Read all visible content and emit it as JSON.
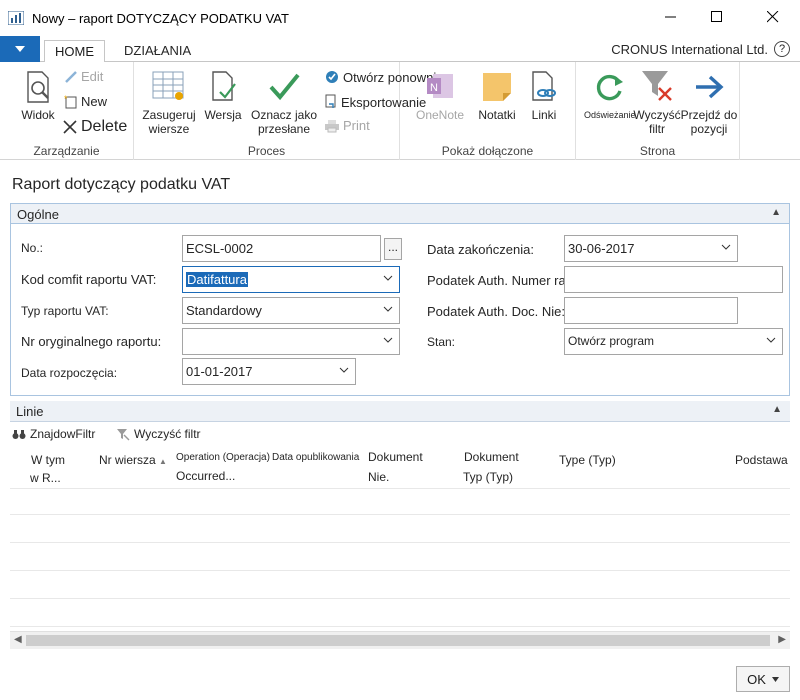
{
  "window": {
    "title": "Nowy – raport DOTYCZĄCY PODATKU VAT"
  },
  "tabs": [
    {
      "label": "HOME",
      "active": true
    },
    {
      "label": "DZIAŁANIA",
      "active": false
    }
  ],
  "company": "CRONUS International Ltd.",
  "ribbon": {
    "zarzadzanie": {
      "label": "Zarządzanie",
      "widok": "Widok",
      "edit": "Edit",
      "new": "New",
      "delete": "Delete"
    },
    "proces": {
      "label": "Proces",
      "zasugeruj": "Zasugeruj wiersze",
      "wersja": "Wersja",
      "oznacz": "Oznacz jako przesłane",
      "otworz": "Otwórz ponownie",
      "eksport": "Eksportowanie",
      "print": "Print"
    },
    "pokaz": {
      "label": "Pokaż dołączone",
      "onenote": "OneNote",
      "notatki": "Notatki",
      "linki": "Linki"
    },
    "strona": {
      "label": "Strona",
      "odswiezanie": "Odświeżanie",
      "wyczysc": "Wyczyść filtr",
      "przejdz": "Przejdź do pozycji"
    }
  },
  "page": {
    "title": "Raport dotyczący podatku VAT"
  },
  "general": {
    "header": "Ogólne",
    "no_label": "No.:",
    "no_value": "ECSL-0002",
    "kod_label": "Kod comfit raportu VAT:",
    "kod_value": "Datifattura",
    "typ_label": "Typ raportu VAT:",
    "typ_value": "Standardowy",
    "nr_label": "Nr oryginalnego raportu:",
    "nr_value": "",
    "data_roz_label": "Data rozpoczęcia:",
    "data_roz_value": "01-01-2017",
    "data_zak_label": "Data zakończenia:",
    "data_zak_value": "30-06-2017",
    "auth_rach_label": "Podatek Auth. Numer rachunku:",
    "auth_rach_value": "",
    "auth_doc_label": "Podatek Auth. Doc. Nie:",
    "auth_doc_value": "",
    "stan_label": "Stan:",
    "stan_value": "Otwórz program"
  },
  "lines": {
    "header": "Linie",
    "find_filter": "ZnajdowFiltr",
    "clear_filter": "Wyczyść filtr",
    "columns": {
      "w_tym": "W tym",
      "w_r": "w R...",
      "nr_wiersza": "Nr wiersza",
      "operation": "Operation (Operacja)",
      "occurred": "Occurred...",
      "data_opub": "Data opublikowania",
      "dok_nie_1": "Dokument",
      "dok_nie_2": "Nie.",
      "dok_typ_1": "Dokument",
      "dok_typ_2": "Typ (Typ)",
      "typ": "Type (Typ)",
      "podstawa": "Podstawa"
    }
  },
  "footer": {
    "ok": "OK"
  }
}
